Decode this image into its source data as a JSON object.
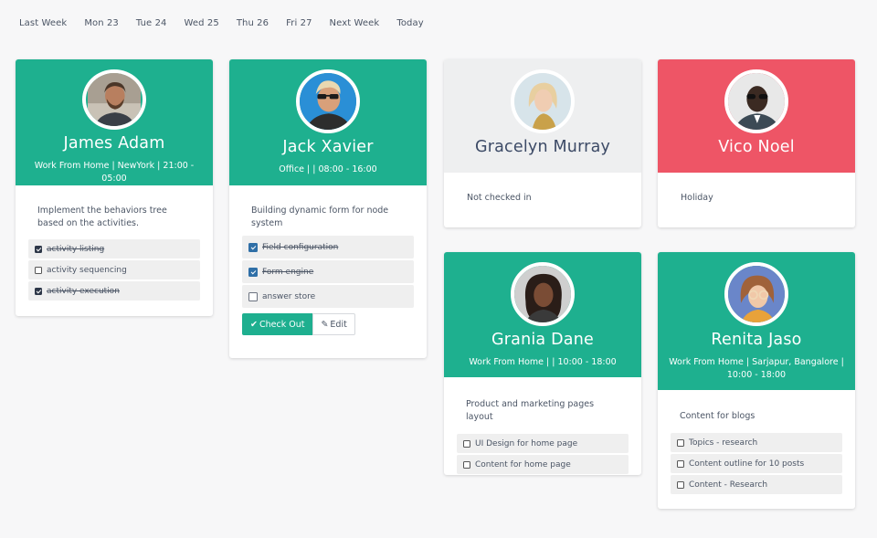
{
  "nav": [
    "Last Week",
    "Mon 23",
    "Tue 24",
    "Wed 25",
    "Thu 26",
    "Fri 27",
    "Next Week",
    "Today"
  ],
  "colors": {
    "green": "#1eb08f",
    "grey": "#eeeff0",
    "red": "#ee5566",
    "navy": "#3c4a66"
  },
  "cards": {
    "james": {
      "name": "James Adam",
      "meta": "Work From Home | NewYork | 21:00 - 05:00",
      "task": "Implement the behaviors tree based on the activities.",
      "checks": [
        "activity listing",
        "activity sequencing",
        "activity execution"
      ]
    },
    "jack": {
      "name": "Jack Xavier",
      "meta": "Office | | 08:00 - 16:00",
      "task": "Building dynamic form for node system",
      "checks": [
        "Field configuration",
        "Form engine",
        "answer store"
      ],
      "checkout": "Check Out",
      "edit": "Edit"
    },
    "gracelyn": {
      "name": "Gracelyn Murray",
      "status": "Not checked in"
    },
    "vico": {
      "name": "Vico Noel",
      "status": "Holiday"
    },
    "grania": {
      "name": "Grania Dane",
      "meta": "Work From Home | | 10:00 - 18:00",
      "task": "Product and marketing pages layout",
      "checks": [
        "UI Design for home page",
        "Content for home page"
      ]
    },
    "renita": {
      "name": "Renita Jaso",
      "meta": "Work From Home | Sarjapur, Bangalore | 10:00 - 18:00",
      "task": "Content for blogs",
      "checks": [
        "Topics - research",
        "Content outline for 10 posts",
        "Content - Research"
      ]
    }
  }
}
